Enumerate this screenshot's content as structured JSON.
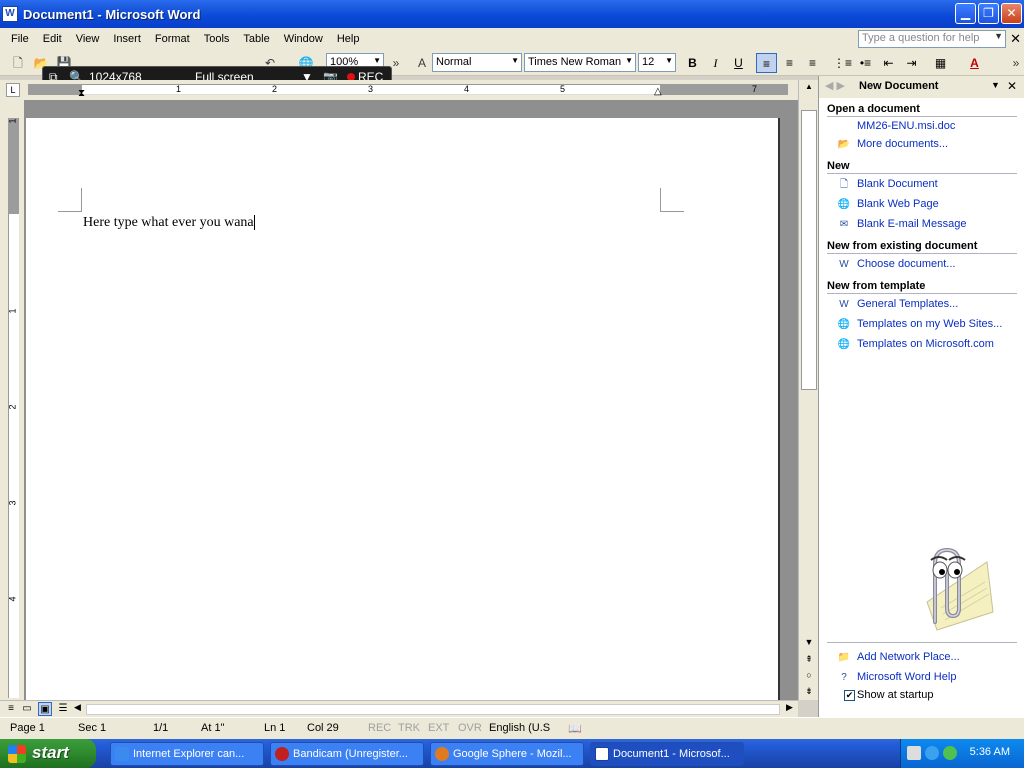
{
  "window": {
    "title": "Document1 - Microsoft Word",
    "app_icon": "W"
  },
  "menubar": {
    "items": [
      "File",
      "Edit",
      "View",
      "Insert",
      "Format",
      "Tools",
      "Table",
      "Window",
      "Help"
    ],
    "help_placeholder": "Type a question for help",
    "close_doc": "✕"
  },
  "toolbar": {
    "zoom": "100%",
    "style": "Normal",
    "font": "Times New Roman",
    "font_size": "12",
    "bold": "B",
    "italic": "I",
    "underline": "U",
    "font_color_glyph": "A"
  },
  "bandicam": {
    "resolution": "1024x768",
    "mode": "Full screen",
    "rec": "REC"
  },
  "ruler": {
    "h_numbers": [
      "1",
      "2",
      "3",
      "4",
      "5",
      "7"
    ],
    "v_numbers": [
      "1",
      "1",
      "2",
      "3",
      "4"
    ],
    "tab_stop": "L"
  },
  "document": {
    "text": "Here type what ever you wana"
  },
  "statusbar": {
    "page": "Page 1",
    "sec": "Sec 1",
    "pages": "1/1",
    "at": "At 1\"",
    "ln": "Ln 1",
    "col": "Col 29",
    "rec": "REC",
    "trk": "TRK",
    "ext": "EXT",
    "ovr": "OVR",
    "language": "English (U.S"
  },
  "taskpane": {
    "title": "New Document",
    "sections": {
      "open": "Open a document",
      "new": "New",
      "existing": "New from existing document",
      "template": "New from template"
    },
    "open_links": [
      "MM26-ENU.msi.doc",
      "More documents..."
    ],
    "new_links": [
      "Blank Document",
      "Blank Web Page",
      "Blank E-mail Message"
    ],
    "existing_links": [
      "Choose document..."
    ],
    "template_links": [
      "General Templates...",
      "Templates on my Web Sites...",
      "Templates on Microsoft.com"
    ],
    "bottom_links": [
      "Add Network Place...",
      "Microsoft Word Help"
    ],
    "show_at_startup": "Show at startup",
    "show_at_startup_checked": "✔"
  },
  "taskbar": {
    "start": "start",
    "tasks": [
      "Internet Explorer can...",
      "Bandicam (Unregister...",
      "Google Sphere - Mozil...",
      "Document1 - Microsof..."
    ],
    "clock": "5:36 AM"
  },
  "colors": {
    "titlebar": "#0a49d8",
    "taskbar": "#245edb",
    "start": "#2d8a2d",
    "link": "#0a2fc0"
  }
}
